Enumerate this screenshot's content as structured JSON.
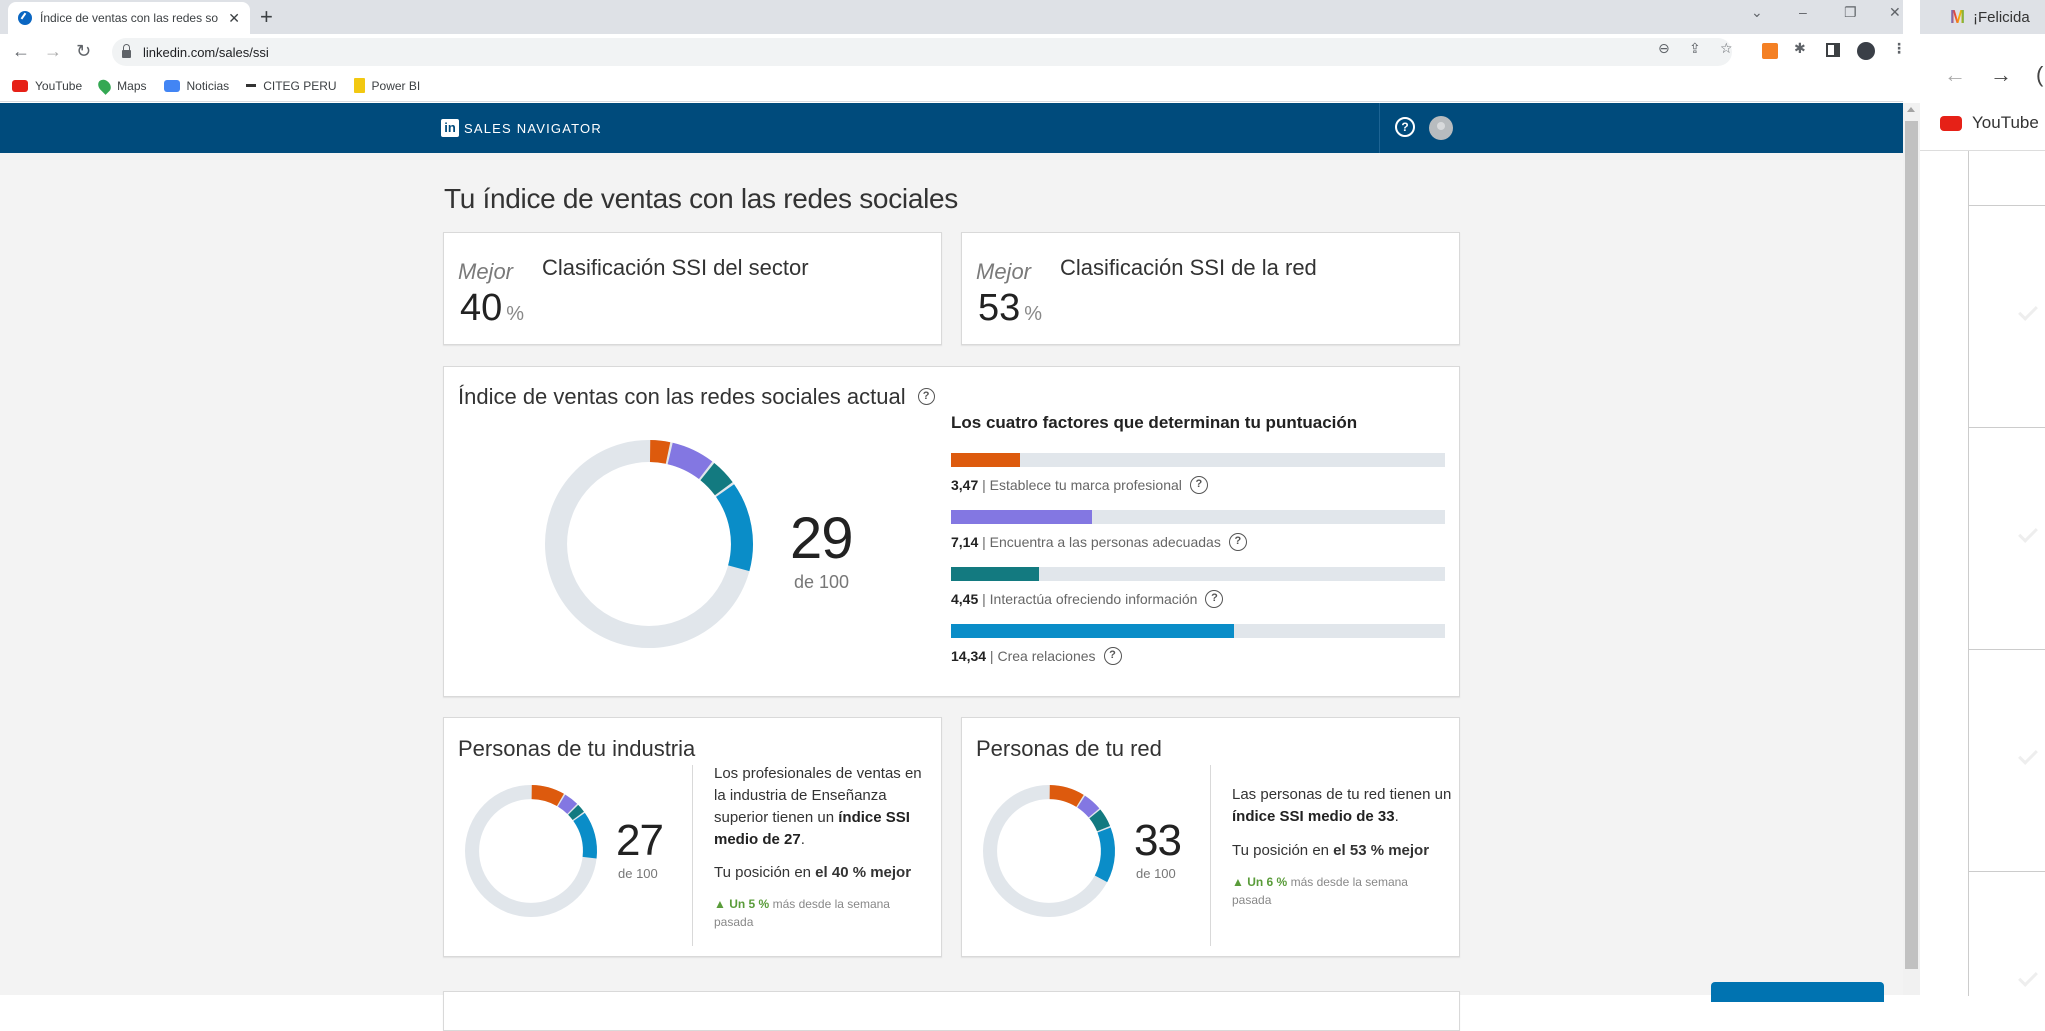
{
  "browser": {
    "tab_title": "Índice de ventas con las redes so",
    "url": "linkedin.com/sales/ssi",
    "bookmarks": [
      {
        "label": "YouTube",
        "icon": "youtube-icon",
        "color": "#e62117"
      },
      {
        "label": "Maps",
        "icon": "maps-pin-icon",
        "color": "#34a853"
      },
      {
        "label": "Noticias",
        "icon": "google-news-icon",
        "color": "#4285f4"
      },
      {
        "label": "CITEG PERU",
        "icon": "citeg-icon",
        "color": "#333333"
      },
      {
        "label": "Power BI",
        "icon": "powerbi-icon",
        "color": "#f2c811"
      }
    ]
  },
  "app": {
    "brand": "SALES NAVIGATOR",
    "logo_text": "in",
    "page_title": "Tu índice de ventas con las redes sociales"
  },
  "rankings": [
    {
      "prefix": "Mejor",
      "label": "Clasificación SSI del sector",
      "value": "40",
      "unit": "%"
    },
    {
      "prefix": "Mejor",
      "label": "Clasificación SSI de la red",
      "value": "53",
      "unit": "%"
    }
  ],
  "ssi_card": {
    "title": "Índice de ventas con las redes sociales actual",
    "score": "29",
    "score_sub": "de 100",
    "factors_title": "Los cuatro factores que determinan tu puntuación"
  },
  "colors": {
    "brand": "#dd5a0d",
    "find": "#8377e2",
    "engage": "#137a80",
    "relationships": "#0a8dc8",
    "track": "#e1e6eb",
    "header": "#004b7c"
  },
  "chart_data": [
    {
      "type": "donut",
      "title": "Índice de ventas con las redes sociales actual",
      "total": 29,
      "max": 100,
      "series": [
        {
          "name": "Establece tu marca profesional",
          "value": 3.47,
          "max": 25
        },
        {
          "name": "Encuentra a las personas adecuadas",
          "value": 7.14,
          "max": 25
        },
        {
          "name": "Interactúa ofreciendo información",
          "value": 4.45,
          "max": 25
        },
        {
          "name": "Crea relaciones",
          "value": 14.34,
          "max": 25
        }
      ]
    },
    {
      "type": "bar",
      "title": "Los cuatro factores que determinan tu puntuación",
      "categories": [
        "Establece tu marca profesional",
        "Encuentra a las personas adecuadas",
        "Interactúa ofreciendo información",
        "Crea relaciones"
      ],
      "values": [
        3.47,
        7.14,
        4.45,
        14.34
      ],
      "value_labels": [
        "3,47",
        "7,14",
        "4,45",
        "14,34"
      ],
      "xlim": [
        0,
        25
      ]
    },
    {
      "type": "donut",
      "title": "Personas de tu industria",
      "total": 27,
      "max": 100,
      "series": [
        {
          "name": "Establece tu marca profesional",
          "value": 8.5
        },
        {
          "name": "Encuentra a las personas adecuadas",
          "value": 4
        },
        {
          "name": "Interactúa ofreciendo información",
          "value": 2.5
        },
        {
          "name": "Crea relaciones",
          "value": 12
        }
      ]
    },
    {
      "type": "donut",
      "title": "Personas de tu red",
      "total": 33,
      "max": 100,
      "series": [
        {
          "name": "Establece tu marca profesional",
          "value": 9
        },
        {
          "name": "Encuentra a las personas adecuadas",
          "value": 5
        },
        {
          "name": "Interactúa ofreciendo información",
          "value": 5
        },
        {
          "name": "Crea relaciones",
          "value": 14
        }
      ]
    }
  ],
  "industry_card": {
    "title": "Personas de tu industria",
    "score": "27",
    "score_sub": "de 100",
    "desc_1": "Los profesionales de ventas en la industria de Enseñanza superior tienen un ",
    "desc_bold": "índice SSI medio de 27",
    "desc_end": ".",
    "pos_prefix": "Tu posición en ",
    "pos_bold": "el 40 % mejor",
    "trend_up": "Un 5 %",
    "trend_text": " más desde la semana pasada"
  },
  "network_card": {
    "title": "Personas de tu red",
    "score": "33",
    "score_sub": "de 100",
    "desc_1": "Las personas de tu red tienen un ",
    "desc_bold": "índice SSI medio de 33",
    "desc_end": ".",
    "pos_prefix": "Tu posición en ",
    "pos_bold": "el 53 % mejor",
    "trend_up": "Un 6 %",
    "trend_text": " más desde la semana pasada"
  },
  "second_window": {
    "tab_title": "¡Felicida",
    "bookmark": "YouTube"
  }
}
